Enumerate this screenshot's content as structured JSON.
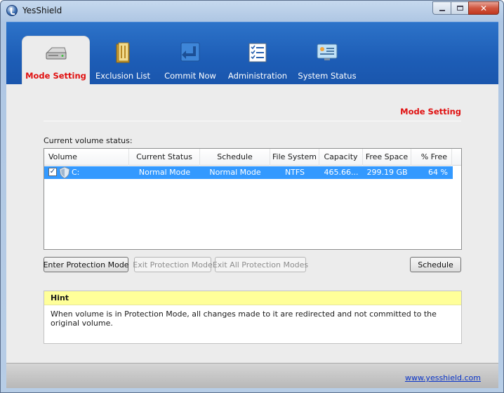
{
  "window": {
    "title": "YesShield"
  },
  "tabs": [
    {
      "label": "Mode Setting",
      "icon": "hard-drive-icon",
      "active": true
    },
    {
      "label": "Exclusion List",
      "icon": "folder-icon",
      "active": false
    },
    {
      "label": "Commit Now",
      "icon": "commit-arrow-icon",
      "active": false
    },
    {
      "label": "Administration",
      "icon": "checklist-icon",
      "active": false
    },
    {
      "label": "System Status",
      "icon": "monitor-status-icon",
      "active": false
    }
  ],
  "main": {
    "section_title": "Mode Setting",
    "status_label": "Current volume status:",
    "table": {
      "columns": [
        "Volume",
        "Current Status",
        "Schedule",
        "File System",
        "Capacity",
        "Free Space",
        "% Free"
      ],
      "rows": [
        {
          "checked": true,
          "volume": "C:",
          "current_status": "Normal Mode",
          "schedule": "Normal Mode",
          "file_system": "NTFS",
          "capacity": "465.66...",
          "free_space": "299.19 GB",
          "pct_free": "64 %"
        }
      ]
    },
    "buttons": {
      "enter": "Enter Protection Mode",
      "exit": "Exit Protection Mode",
      "exit_all": "Exit All Protection Modes",
      "schedule": "Schedule"
    },
    "hint": {
      "title": "Hint",
      "text": "When volume is in Protection Mode, all changes made to it are redirected and not committed to the original volume."
    }
  },
  "footer": {
    "link": "www.yesshield.com"
  },
  "colors": {
    "header_blue": "#1d5db6",
    "active_tab_text": "#e01010",
    "row_selected": "#3399ff",
    "hint_yellow": "#ffff99",
    "link": "#0a34c8"
  }
}
